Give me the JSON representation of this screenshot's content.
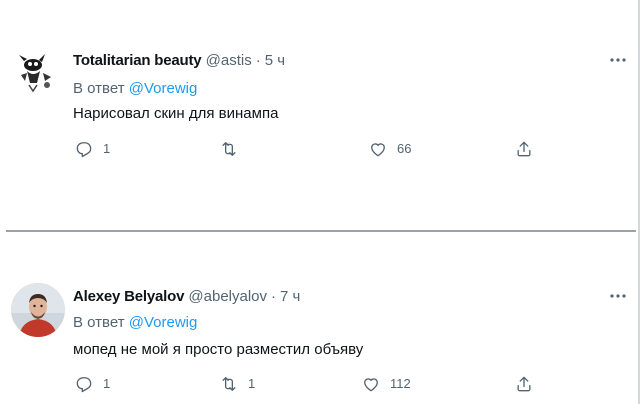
{
  "tweets": [
    {
      "display_name": "Totalitarian beauty",
      "handle": "@astis",
      "separator": "·",
      "time": "5 ч",
      "reply_prefix": "В ответ",
      "reply_to": "@Vorewig",
      "text": "Нарисовал скин для винампа",
      "more_icon": "more-horizontal-icon",
      "actions": {
        "reply": {
          "icon": "reply-icon",
          "count": "1"
        },
        "retweet": {
          "icon": "retweet-icon",
          "count": ""
        },
        "like": {
          "icon": "heart-icon",
          "count": "66"
        },
        "share": {
          "icon": "share-icon"
        }
      }
    },
    {
      "display_name": "Alexey Belyalov",
      "handle": "@abelyalov",
      "separator": "·",
      "time": "7 ч",
      "reply_prefix": "В ответ",
      "reply_to": "@Vorewig",
      "text": "мопед не мой я просто разместил объяву",
      "more_icon": "more-horizontal-icon",
      "actions": {
        "reply": {
          "icon": "reply-icon",
          "count": "1"
        },
        "retweet": {
          "icon": "retweet-icon",
          "count": "1"
        },
        "like": {
          "icon": "heart-icon",
          "count": "112"
        },
        "share": {
          "icon": "share-icon"
        }
      }
    }
  ],
  "colors": {
    "text_primary": "#0f1419",
    "text_secondary": "#536471",
    "accent": "#1d9bf0",
    "divider": "#9aa2a8"
  }
}
